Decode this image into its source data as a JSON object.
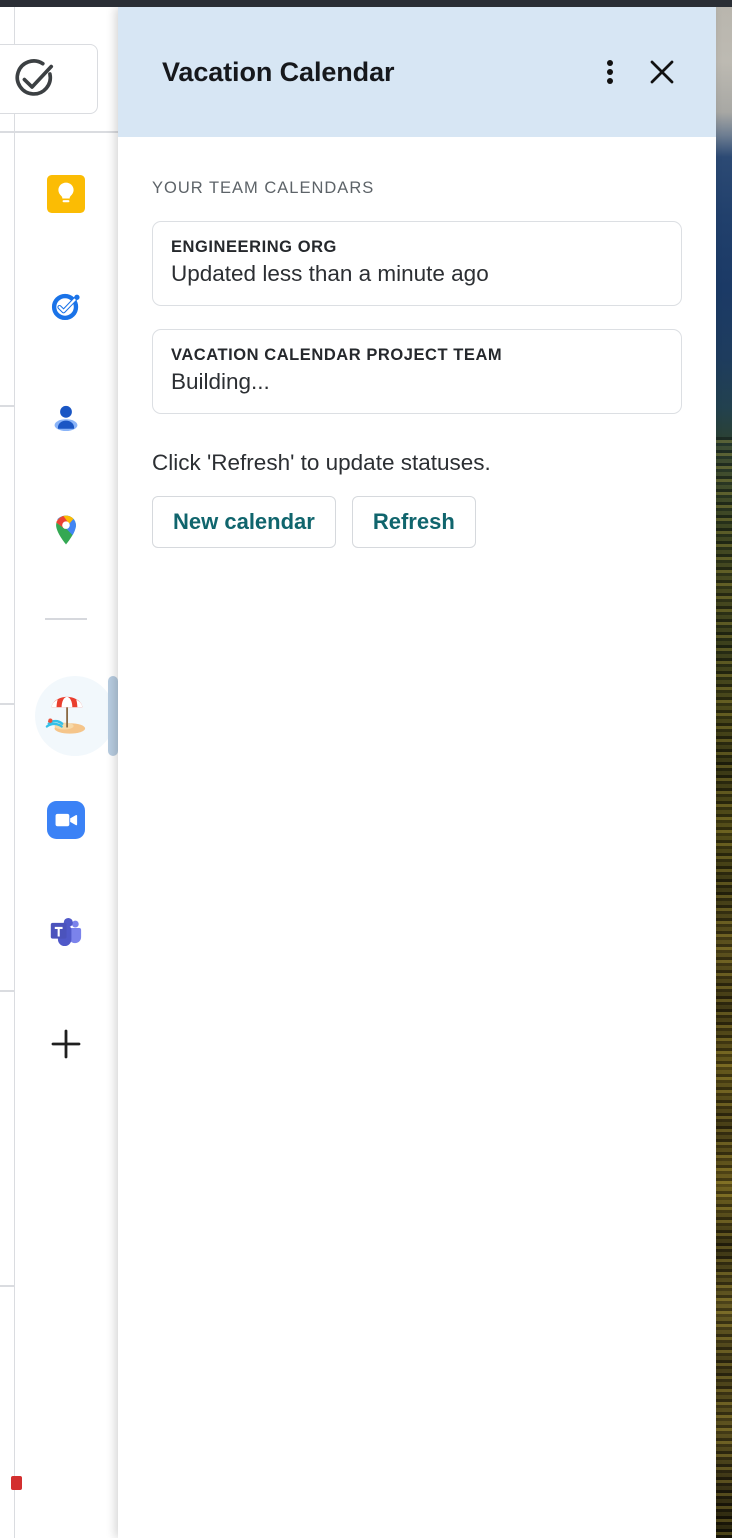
{
  "window": {
    "top_bar_color": "#2a2e35",
    "background_description": "landscape photo"
  },
  "app_rail": {
    "tasks_button": {
      "icon": "check-circle-icon"
    },
    "items": [
      {
        "name": "google-keep",
        "icon": "lightbulb-icon",
        "selected": false
      },
      {
        "name": "google-tasks",
        "icon": "task-check-icon",
        "selected": false
      },
      {
        "name": "google-contacts",
        "icon": "person-icon",
        "selected": false
      },
      {
        "name": "google-maps",
        "icon": "map-pin-icon",
        "selected": false
      },
      {
        "name": "vacation-calendar",
        "icon": "beach-umbrella-icon",
        "selected": true
      },
      {
        "name": "zoom",
        "icon": "video-camera-icon",
        "selected": false
      },
      {
        "name": "microsoft-teams",
        "icon": "teams-icon",
        "selected": false
      }
    ],
    "add_button": {
      "icon": "plus-icon",
      "label": "+"
    }
  },
  "panel": {
    "header": {
      "title": "Vacation Calendar",
      "background_color": "#d7e6f4",
      "menu_icon": "kebab-menu-icon",
      "close_icon": "close-icon"
    },
    "section_label": "YOUR TEAM CALENDARS",
    "calendars": [
      {
        "name": "ENGINEERING ORG",
        "status": "Updated less than a minute ago"
      },
      {
        "name": "VACATION CALENDAR PROJECT TEAM",
        "status": "Building..."
      }
    ],
    "hint": "Click 'Refresh' to update statuses.",
    "buttons": [
      {
        "label": "New calendar",
        "color": "#10656d"
      },
      {
        "label": "Refresh",
        "color": "#10656d"
      }
    ]
  }
}
